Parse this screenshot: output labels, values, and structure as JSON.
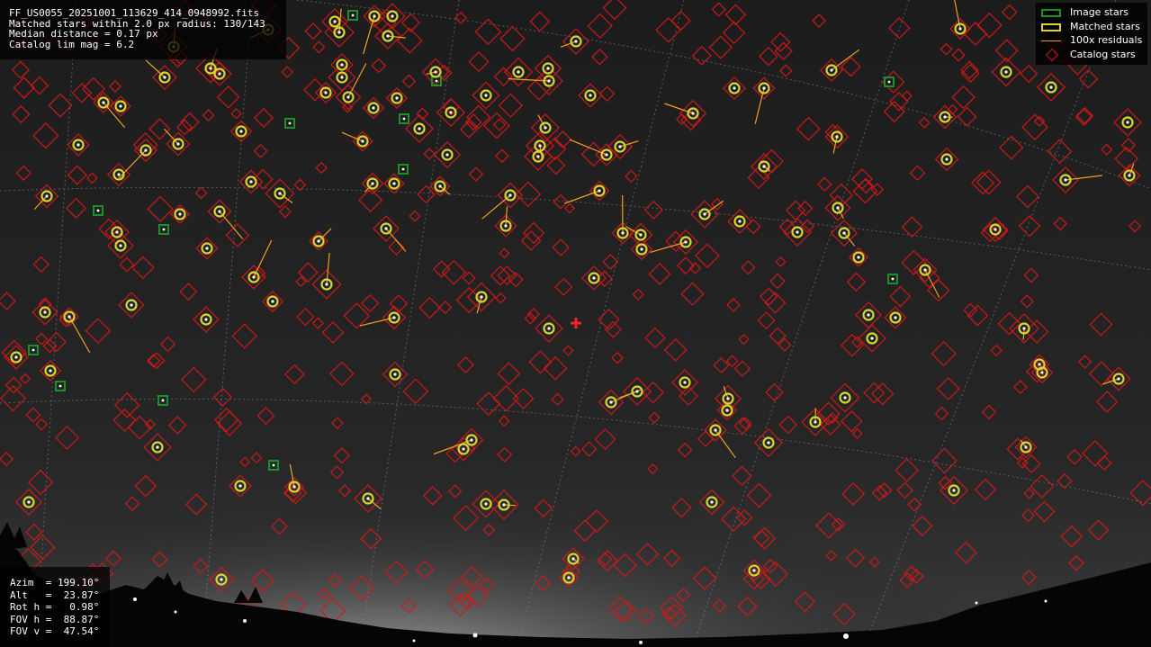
{
  "header": {
    "filename": "FF_US0055_20251001_113629_414_0948992.fits",
    "matched_line": "Matched stars within 2.0 px radius: 130/143",
    "median_line": "Median distance = 0.17 px",
    "catalog_line": "Catalog lim mag = 6.2"
  },
  "legend": {
    "items": [
      {
        "label": "Image stars",
        "symbol": "green-square-icon"
      },
      {
        "label": "Matched stars",
        "symbol": "yellow-circle-icon"
      },
      {
        "label": "100x residuals",
        "symbol": "orange-line-icon"
      },
      {
        "label": "Catalog stars",
        "symbol": "red-diamond-icon"
      }
    ]
  },
  "pointing": {
    "azim": "Azim  = 199.10°",
    "alt": "Alt   =  23.87°",
    "rot": "Rot h =   0.98°",
    "fov_h": "FOV h =  88.87°",
    "fov_v": "FOV v =  47.54°"
  },
  "colors": {
    "image_star": "#1a8f2a",
    "matched_star": "#d7d52f",
    "residual": "#f0a020",
    "catalog_star": "#d01818",
    "center_mark": "#ff2020"
  },
  "matched_stars": [
    [
      372,
      24
    ],
    [
      416,
      18
    ],
    [
      436,
      18
    ],
    [
      377,
      36
    ],
    [
      431,
      40
    ],
    [
      640,
      46
    ],
    [
      1067,
      32
    ],
    [
      576,
      80
    ],
    [
      609,
      76
    ],
    [
      610,
      90
    ],
    [
      484,
      80
    ],
    [
      380,
      72
    ],
    [
      380,
      86
    ],
    [
      362,
      103
    ],
    [
      387,
      108
    ],
    [
      415,
      120
    ],
    [
      441,
      109
    ],
    [
      540,
      106
    ],
    [
      501,
      125
    ],
    [
      466,
      143
    ],
    [
      403,
      157
    ],
    [
      656,
      106
    ],
    [
      770,
      126
    ],
    [
      816,
      98
    ],
    [
      849,
      98
    ],
    [
      924,
      78
    ],
    [
      1118,
      80
    ],
    [
      1168,
      97
    ],
    [
      1050,
      130
    ],
    [
      930,
      152
    ],
    [
      1253,
      136
    ],
    [
      115,
      114
    ],
    [
      134,
      118
    ],
    [
      87,
      161
    ],
    [
      162,
      167
    ],
    [
      183,
      86
    ],
    [
      234,
      76
    ],
    [
      244,
      82
    ],
    [
      193,
      52
    ],
    [
      268,
      146
    ],
    [
      198,
      160
    ],
    [
      600,
      162
    ],
    [
      598,
      174
    ],
    [
      674,
      172
    ],
    [
      689,
      163
    ],
    [
      606,
      142
    ],
    [
      497,
      172
    ],
    [
      489,
      207
    ],
    [
      567,
      217
    ],
    [
      666,
      212
    ],
    [
      849,
      185
    ],
    [
      1052,
      177
    ],
    [
      1184,
      200
    ],
    [
      1255,
      195
    ],
    [
      132,
      194
    ],
    [
      52,
      218
    ],
    [
      279,
      202
    ],
    [
      311,
      215
    ],
    [
      244,
      235
    ],
    [
      200,
      238
    ],
    [
      414,
      204
    ],
    [
      438,
      204
    ],
    [
      429,
      254
    ],
    [
      354,
      268
    ],
    [
      562,
      251
    ],
    [
      692,
      259
    ],
    [
      712,
      261
    ],
    [
      713,
      277
    ],
    [
      783,
      238
    ],
    [
      822,
      246
    ],
    [
      762,
      269
    ],
    [
      886,
      258
    ],
    [
      931,
      231
    ],
    [
      938,
      259
    ],
    [
      954,
      286
    ],
    [
      1106,
      255
    ],
    [
      1028,
      300
    ],
    [
      130,
      258
    ],
    [
      134,
      273
    ],
    [
      230,
      276
    ],
    [
      282,
      308
    ],
    [
      363,
      316
    ],
    [
      303,
      335
    ],
    [
      660,
      309
    ],
    [
      535,
      330
    ],
    [
      50,
      347
    ],
    [
      77,
      352
    ],
    [
      146,
      339
    ],
    [
      229,
      355
    ],
    [
      438,
      353
    ],
    [
      610,
      365
    ],
    [
      965,
      350
    ],
    [
      995,
      353
    ],
    [
      969,
      376
    ],
    [
      1138,
      365
    ],
    [
      18,
      397
    ],
    [
      56,
      412
    ],
    [
      439,
      416
    ],
    [
      761,
      425
    ],
    [
      708,
      435
    ],
    [
      679,
      447
    ],
    [
      809,
      443
    ],
    [
      808,
      456
    ],
    [
      939,
      442
    ],
    [
      1155,
      405
    ],
    [
      1158,
      414
    ],
    [
      1243,
      421
    ],
    [
      906,
      469
    ],
    [
      795,
      478
    ],
    [
      854,
      492
    ],
    [
      1140,
      497
    ],
    [
      175,
      497
    ],
    [
      524,
      489
    ],
    [
      515,
      499
    ],
    [
      327,
      541
    ],
    [
      267,
      540
    ],
    [
      32,
      558
    ],
    [
      409,
      554
    ],
    [
      540,
      560
    ],
    [
      560,
      561
    ],
    [
      791,
      558
    ],
    [
      1060,
      545
    ],
    [
      637,
      621
    ],
    [
      632,
      642
    ],
    [
      838,
      634
    ],
    [
      246,
      644
    ],
    [
      298,
      33
    ]
  ],
  "image_stars": [
    [
      392,
      17
    ],
    [
      485,
      90
    ],
    [
      322,
      137
    ],
    [
      449,
      132
    ],
    [
      448,
      188
    ],
    [
      109,
      234
    ],
    [
      182,
      255
    ],
    [
      988,
      91
    ],
    [
      992,
      310
    ],
    [
      37,
      389
    ],
    [
      67,
      429
    ],
    [
      181,
      445
    ],
    [
      304,
      517
    ]
  ]
}
